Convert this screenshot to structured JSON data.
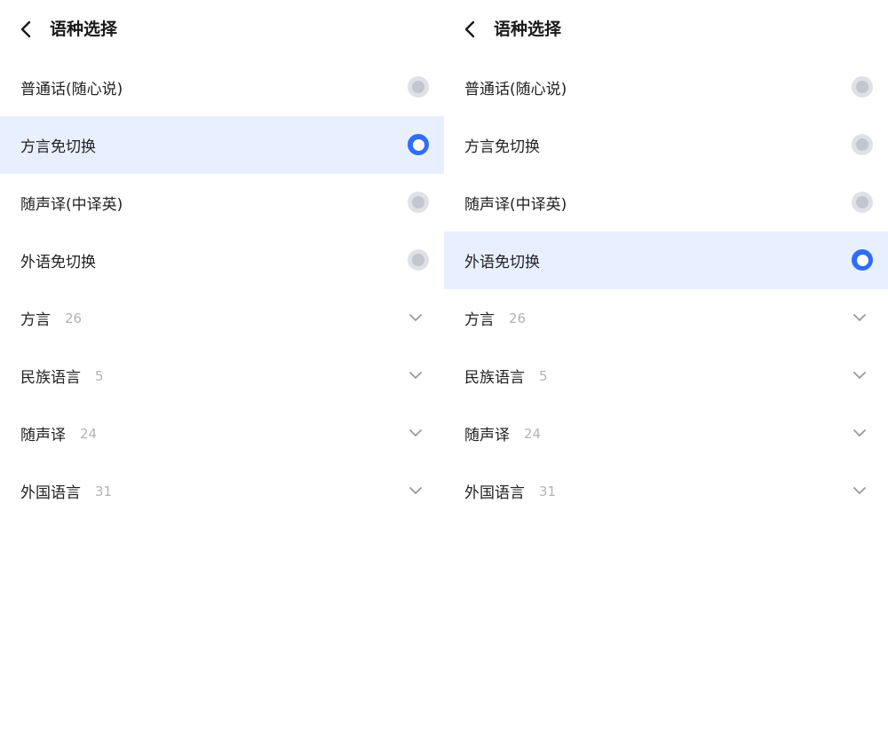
{
  "colors": {
    "accent": "#2f6dfa",
    "selected_row_bg": "#e8efff",
    "radio_off": "#dfe1e6",
    "count_text": "#b3b3b3"
  },
  "screens": [
    {
      "header": {
        "title": "语种选择",
        "back_icon": "chevron-left-icon"
      },
      "options": [
        {
          "label": "普通话(随心说)",
          "selected": false
        },
        {
          "label": "方言免切换",
          "selected": true
        },
        {
          "label": "随声译(中译英)",
          "selected": false
        },
        {
          "label": "外语免切换",
          "selected": false
        }
      ],
      "groups": [
        {
          "label": "方言",
          "count": "26",
          "icon": "chevron-down-icon"
        },
        {
          "label": "民族语言",
          "count": "5",
          "icon": "chevron-down-icon"
        },
        {
          "label": "随声译",
          "count": "24",
          "icon": "chevron-down-icon"
        },
        {
          "label": "外国语言",
          "count": "31",
          "icon": "chevron-down-icon"
        }
      ]
    },
    {
      "header": {
        "title": "语种选择",
        "back_icon": "chevron-left-icon"
      },
      "options": [
        {
          "label": "普通话(随心说)",
          "selected": false
        },
        {
          "label": "方言免切换",
          "selected": false
        },
        {
          "label": "随声译(中译英)",
          "selected": false
        },
        {
          "label": "外语免切换",
          "selected": true
        }
      ],
      "groups": [
        {
          "label": "方言",
          "count": "26",
          "icon": "chevron-down-icon"
        },
        {
          "label": "民族语言",
          "count": "5",
          "icon": "chevron-down-icon"
        },
        {
          "label": "随声译",
          "count": "24",
          "icon": "chevron-down-icon"
        },
        {
          "label": "外国语言",
          "count": "31",
          "icon": "chevron-down-icon"
        }
      ]
    }
  ]
}
